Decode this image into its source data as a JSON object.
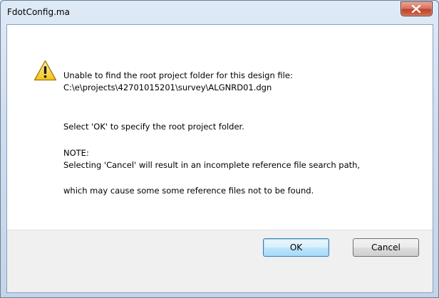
{
  "window": {
    "title": "FdotConfig.ma",
    "close_icon": "close-icon"
  },
  "message": {
    "icon": "warning-icon",
    "line1": "Unable to find the root project folder for this design file:",
    "line2": "C:\\e\\projects\\42701015201\\survey\\ALGNRD01.dgn",
    "line3": "Select 'OK' to specify the root project folder.",
    "line4": "NOTE:",
    "line5": "Selecting 'Cancel' will result in an incomplete reference file search path,",
    "line6": "which may cause some some reference files not to be found."
  },
  "buttons": {
    "ok_label": "OK",
    "cancel_label": "Cancel"
  }
}
